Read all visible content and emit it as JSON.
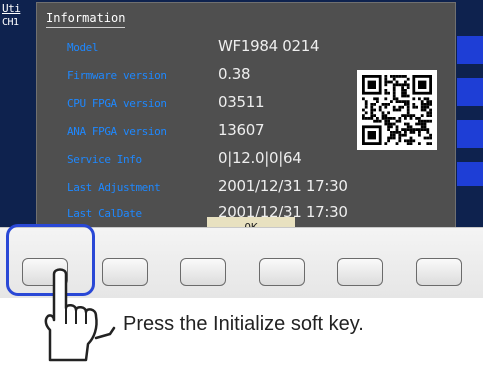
{
  "edge": {
    "tab_label": "Uti",
    "channel_label": "CH1"
  },
  "dialog": {
    "title": "Information",
    "rows": [
      {
        "label": "Model",
        "value": "WF1984  0214"
      },
      {
        "label": "Firmware version",
        "value": "0.38"
      },
      {
        "label": "CPU FPGA version",
        "value": "03511"
      },
      {
        "label": "ANA FPGA version",
        "value": "13607"
      },
      {
        "label": "Service Info",
        "value": "0|12.0|0|64"
      },
      {
        "label": "Last Adjustment",
        "value": "2001/12/31 17:30"
      },
      {
        "label": "Last CalDate",
        "value": "2001/12/31 17:30"
      }
    ],
    "ok_label": "OK"
  },
  "caption": "Press the Initialize soft key.",
  "colors": {
    "label": "#1e88ff",
    "highlight": "#2a48d6",
    "screen": "#0b1a3d"
  },
  "icons": [
    "qr-code-icon",
    "pointing-hand-icon"
  ]
}
